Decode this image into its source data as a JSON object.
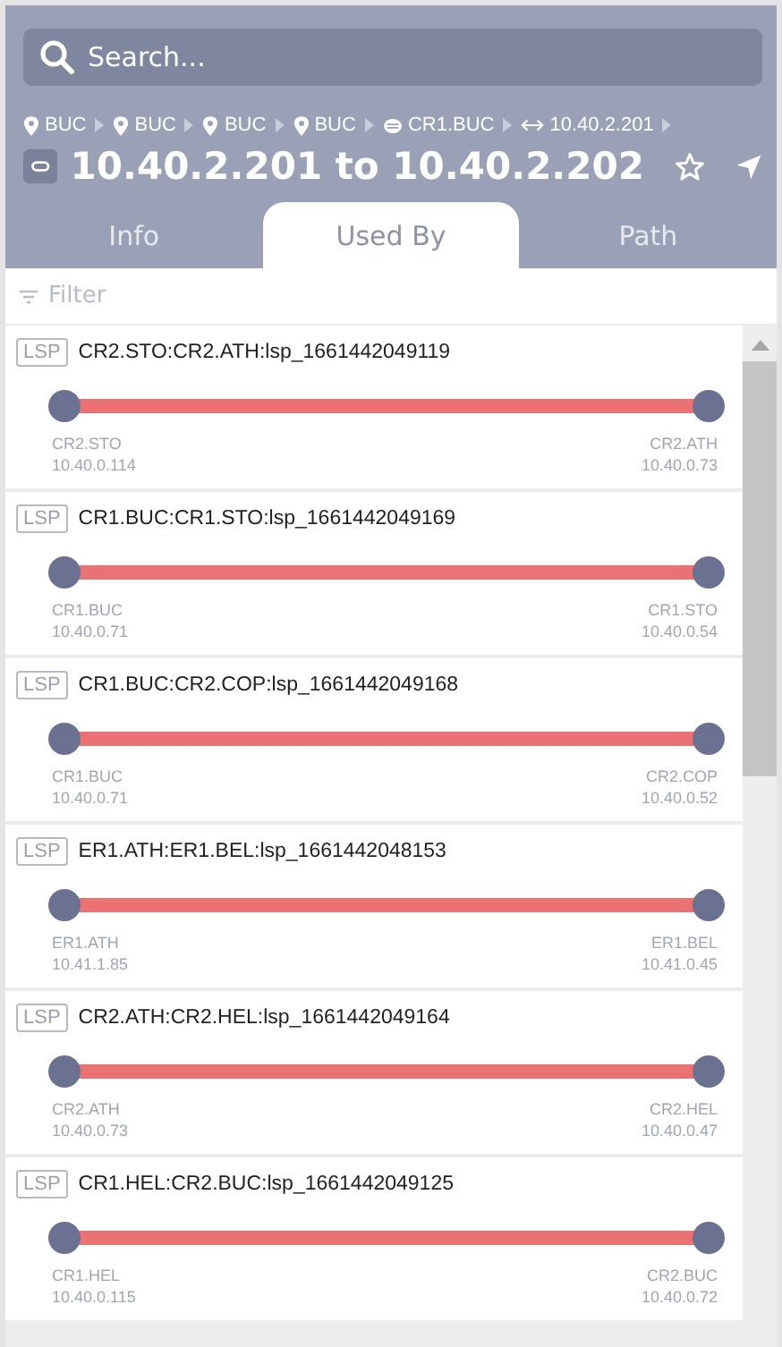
{
  "search": {
    "placeholder": "Search..."
  },
  "breadcrumb": [
    {
      "kind": "site",
      "label": "BUC"
    },
    {
      "kind": "site",
      "label": "BUC"
    },
    {
      "kind": "site",
      "label": "BUC"
    },
    {
      "kind": "site",
      "label": "BUC"
    },
    {
      "kind": "router",
      "label": "CR1.BUC"
    },
    {
      "kind": "interface",
      "label": "10.40.2.201"
    }
  ],
  "title": "10.40.2.201 to 10.40.2.202",
  "tabs": [
    {
      "label": "Info",
      "selected": false
    },
    {
      "label": "Used By",
      "selected": true
    },
    {
      "label": "Path",
      "selected": false
    }
  ],
  "filter": {
    "placeholder": "Filter"
  },
  "lsps": [
    {
      "badge": "LSP",
      "name": "CR2.STO:CR2.ATH:lsp_1661442049119",
      "from": {
        "name": "CR2.STO",
        "ip": "10.40.0.114"
      },
      "to": {
        "name": "CR2.ATH",
        "ip": "10.40.0.73"
      }
    },
    {
      "badge": "LSP",
      "name": "CR1.BUC:CR1.STO:lsp_1661442049169",
      "from": {
        "name": "CR1.BUC",
        "ip": "10.40.0.71"
      },
      "to": {
        "name": "CR1.STO",
        "ip": "10.40.0.54"
      }
    },
    {
      "badge": "LSP",
      "name": "CR1.BUC:CR2.COP:lsp_1661442049168",
      "from": {
        "name": "CR1.BUC",
        "ip": "10.40.0.71"
      },
      "to": {
        "name": "CR2.COP",
        "ip": "10.40.0.52"
      }
    },
    {
      "badge": "LSP",
      "name": "ER1.ATH:ER1.BEL:lsp_1661442048153",
      "from": {
        "name": "ER1.ATH",
        "ip": "10.41.1.85"
      },
      "to": {
        "name": "ER1.BEL",
        "ip": "10.41.0.45"
      }
    },
    {
      "badge": "LSP",
      "name": "CR2.ATH:CR2.HEL:lsp_1661442049164",
      "from": {
        "name": "CR2.ATH",
        "ip": "10.40.0.73"
      },
      "to": {
        "name": "CR2.HEL",
        "ip": "10.40.0.47"
      }
    },
    {
      "badge": "LSP",
      "name": "CR1.HEL:CR2.BUC:lsp_1661442049125",
      "from": {
        "name": "CR1.HEL",
        "ip": "10.40.0.115"
      },
      "to": {
        "name": "CR2.BUC",
        "ip": "10.40.0.72"
      }
    }
  ]
}
